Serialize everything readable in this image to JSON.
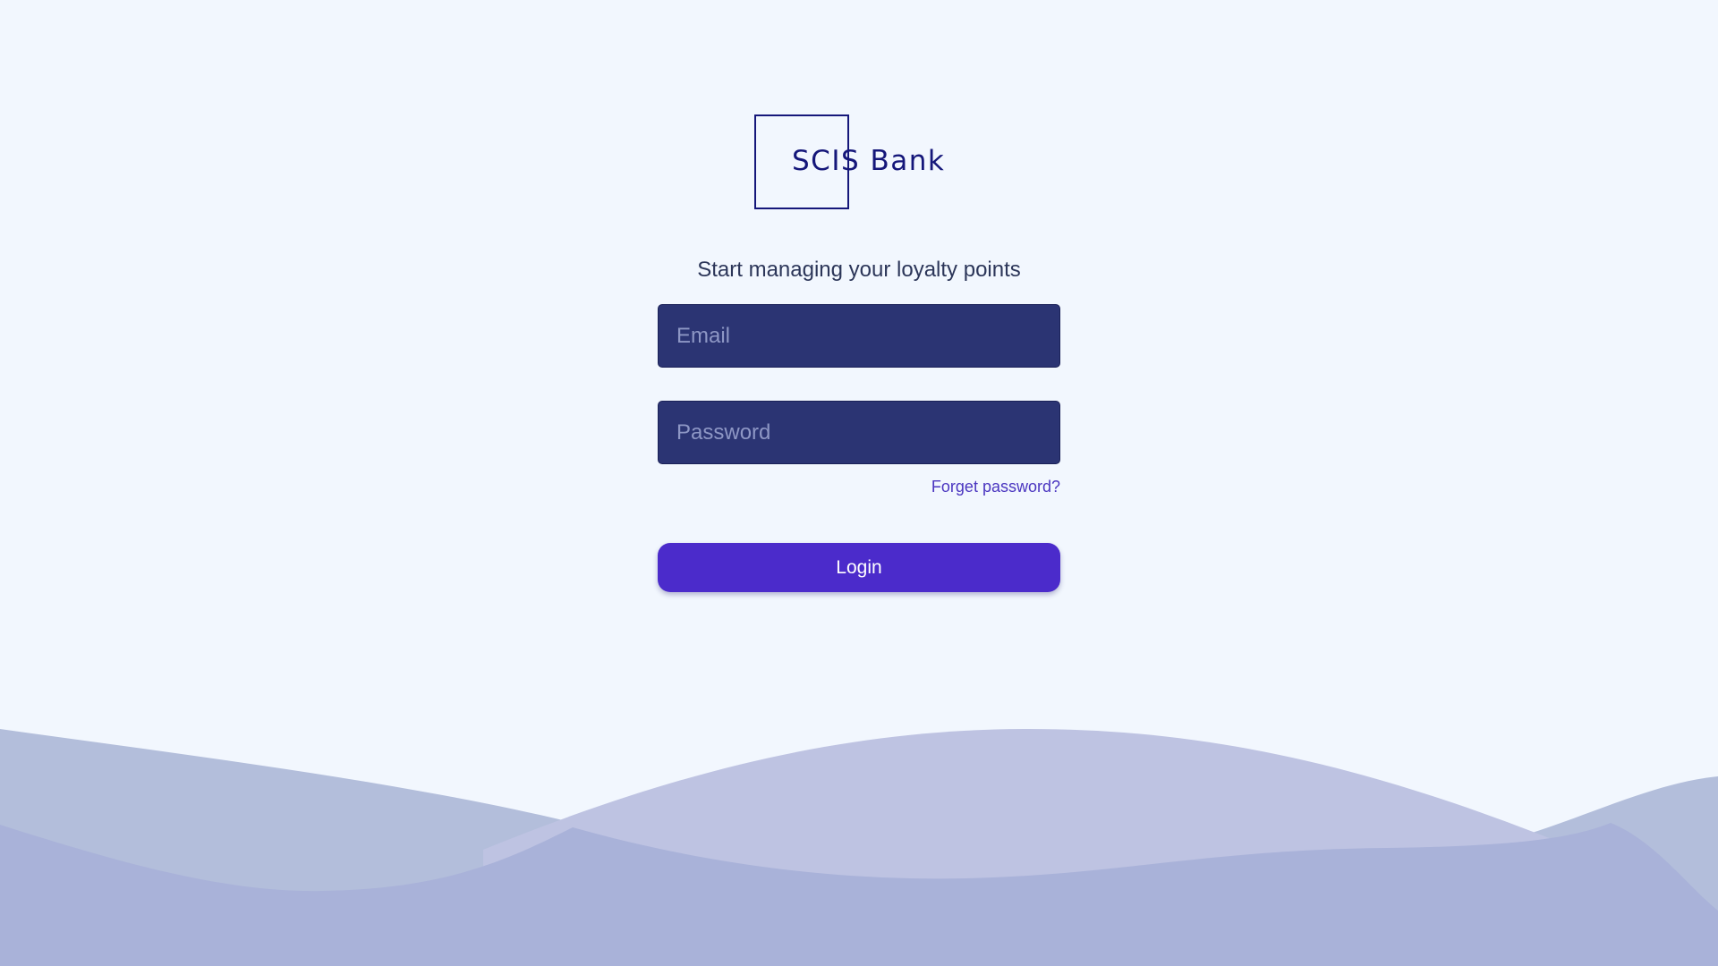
{
  "brand": {
    "logo_text": "SCIS Bank",
    "color": "#15177a"
  },
  "login": {
    "subtitle": "Start managing your loyalty points",
    "email_placeholder": "Email",
    "email_value": "",
    "password_placeholder": "Password",
    "password_value": "",
    "forgot_label": "Forget password?",
    "login_label": "Login"
  },
  "colors": {
    "background": "#f2f7fe",
    "field": "#2b3473",
    "button": "#4b2bcb",
    "link": "#4b36c0",
    "wave_light": "#bec3e2",
    "wave_dark": "#a9b2d9"
  }
}
